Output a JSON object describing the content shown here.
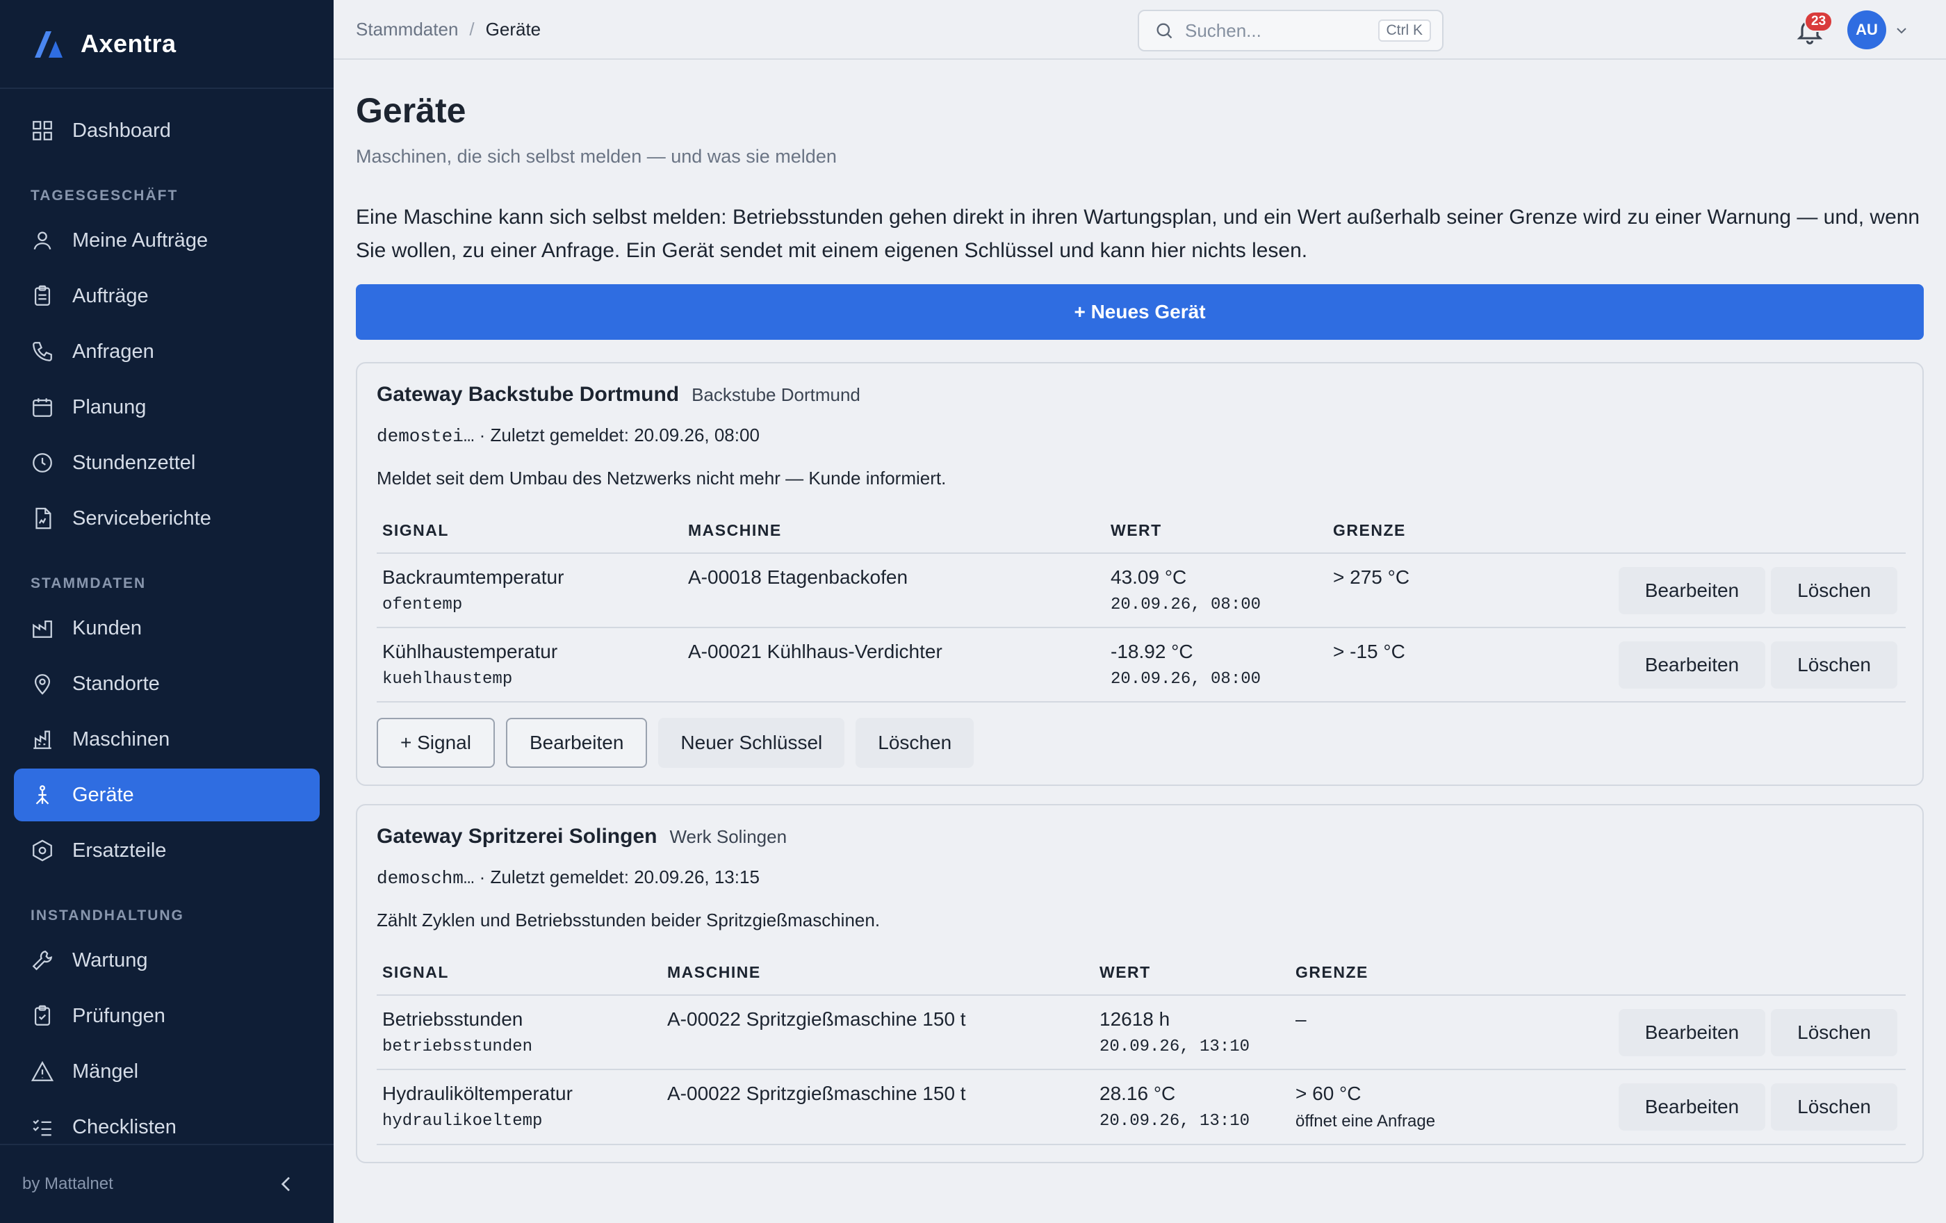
{
  "brand": {
    "name": "Axentra"
  },
  "sidebar": {
    "items": [
      {
        "label": "Dashboard"
      },
      {
        "section": "TAGESGESCHÄFT"
      },
      {
        "label": "Meine Aufträge"
      },
      {
        "label": "Aufträge"
      },
      {
        "label": "Anfragen"
      },
      {
        "label": "Planung"
      },
      {
        "label": "Stundenzettel"
      },
      {
        "label": "Serviceberichte"
      },
      {
        "section": "STAMMDATEN"
      },
      {
        "label": "Kunden"
      },
      {
        "label": "Standorte"
      },
      {
        "label": "Maschinen"
      },
      {
        "label": "Geräte",
        "active": true
      },
      {
        "label": "Ersatzteile"
      },
      {
        "section": "INSTANDHALTUNG"
      },
      {
        "label": "Wartung"
      },
      {
        "label": "Prüfungen"
      },
      {
        "label": "Mängel"
      },
      {
        "label": "Checklisten"
      }
    ],
    "footer": "by Mattalnet"
  },
  "topbar": {
    "breadcrumb": [
      "Stammdaten",
      "Geräte"
    ],
    "breadcrumb_sep": "/",
    "search_placeholder": "Suchen...",
    "search_shortcut": "Ctrl K",
    "notifications": "23",
    "avatar": "AU"
  },
  "page": {
    "title": "Geräte",
    "subtitle": "Maschinen, die sich selbst melden — und was sie melden",
    "intro": "Eine Maschine kann sich selbst melden: Betriebsstunden gehen direkt in ihren Wartungsplan, und ein Wert außerhalb seiner Grenze wird zu einer Warnung — und, wenn Sie wollen, zu einer Anfrage. Ein Gerät sendet mit einem eigenen Schlüssel und kann hier nichts lesen.",
    "new_device_button": "+ Neues Gerät"
  },
  "table_headers": {
    "signal": "SIGNAL",
    "machine": "MASCHINE",
    "value": "WERT",
    "limit": "GRENZE"
  },
  "row_actions": {
    "edit": "Bearbeiten",
    "delete": "Löschen"
  },
  "card_actions": {
    "signal": "+ Signal",
    "edit": "Bearbeiten",
    "new_key": "Neuer Schlüssel",
    "delete": "Löschen"
  },
  "devices": [
    {
      "name": "Gateway Backstube Dortmund",
      "location": "Backstube Dortmund",
      "key": "demostei…",
      "last_seen": " · Zuletzt gemeldet: 20.09.26, 08:00",
      "note": "Meldet seit dem Umbau des Netzwerks nicht mehr — Kunde informiert.",
      "signals": [
        {
          "name": "Backraumtemperatur",
          "key": "ofentemp",
          "machine": "A-00018 Etagenbackofen",
          "value": "43.09 °C",
          "time": "20.09.26, 08:00",
          "limit": "> 275 °C",
          "limit_note": ""
        },
        {
          "name": "Kühlhaustemperatur",
          "key": "kuehlhaustemp",
          "machine": "A-00021 Kühlhaus-Verdichter",
          "value": "-18.92 °C",
          "time": "20.09.26, 08:00",
          "limit": "> -15 °C",
          "limit_note": ""
        }
      ]
    },
    {
      "name": "Gateway Spritzerei Solingen",
      "location": "Werk Solingen",
      "key": "demoschm…",
      "last_seen": " · Zuletzt gemeldet: 20.09.26, 13:15",
      "note": "Zählt Zyklen und Betriebsstunden beider Spritzgießmaschinen.",
      "signals": [
        {
          "name": "Betriebsstunden",
          "key": "betriebsstunden",
          "machine": "A-00022 Spritzgießmaschine 150 t",
          "value": "12618 h",
          "time": "20.09.26, 13:10",
          "limit": "–",
          "limit_note": ""
        },
        {
          "name": "Hydrauliköltemperatur",
          "key": "hydraulikoeltemp",
          "machine": "A-00022 Spritzgießmaschine 150 t",
          "value": "28.16 °C",
          "time": "20.09.26, 13:10",
          "limit": "> 60 °C",
          "limit_note": "öffnet eine Anfrage"
        }
      ]
    }
  ]
}
